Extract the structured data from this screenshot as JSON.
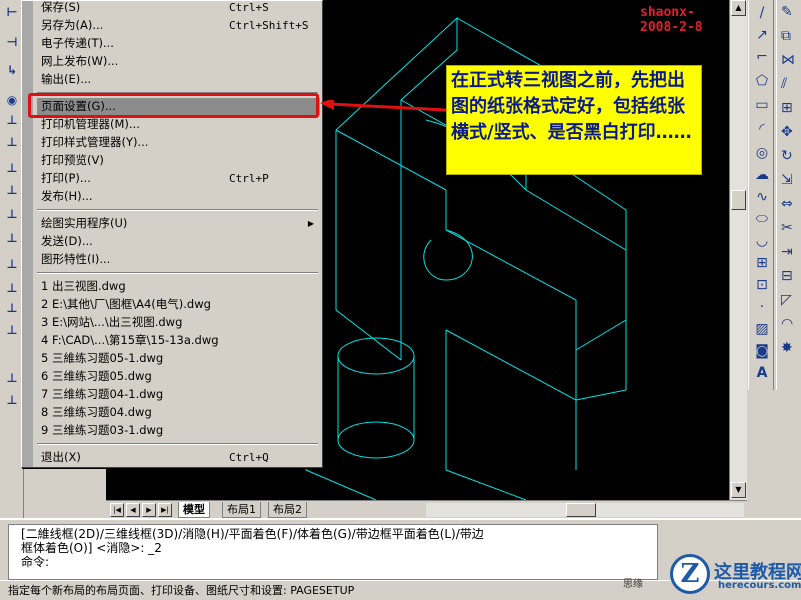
{
  "watermark_stamp": "shaonx-2008-2-8",
  "file_menu": {
    "items": [
      {
        "label": "保存(S)",
        "shortcut": "Ctrl+S"
      },
      {
        "label": "另存为(A)...",
        "shortcut": "Ctrl+Shift+S"
      },
      {
        "label": "电子传递(T)...",
        "shortcut": ""
      },
      {
        "label": "网上发布(W)...",
        "shortcut": ""
      },
      {
        "label": "输出(E)...",
        "shortcut": ""
      },
      {
        "label": "页面设置(G)...",
        "shortcut": ""
      },
      {
        "label": "打印机管理器(M)...",
        "shortcut": ""
      },
      {
        "label": "打印样式管理器(Y)...",
        "shortcut": ""
      },
      {
        "label": "打印预览(V)",
        "shortcut": ""
      },
      {
        "label": "打印(P)...",
        "shortcut": "Ctrl+P"
      },
      {
        "label": "发布(H)...",
        "shortcut": ""
      },
      {
        "label": "绘图实用程序(U)",
        "shortcut": ""
      },
      {
        "label": "发送(D)...",
        "shortcut": ""
      },
      {
        "label": "图形特性(I)...",
        "shortcut": ""
      },
      {
        "label": "1 出三视图.dwg",
        "shortcut": ""
      },
      {
        "label": "2 E:\\其他\\厂\\图框\\A4(电气).dwg",
        "shortcut": ""
      },
      {
        "label": "3 E:\\网站\\...\\出三视图.dwg",
        "shortcut": ""
      },
      {
        "label": "4 F:\\CAD\\...\\第15章\\15-13a.dwg",
        "shortcut": ""
      },
      {
        "label": "5 三維练习题05-1.dwg",
        "shortcut": ""
      },
      {
        "label": "6 三维练习题05.dwg",
        "shortcut": ""
      },
      {
        "label": "7 三维练习题04-1.dwg",
        "shortcut": ""
      },
      {
        "label": "8 三维练习题04.dwg",
        "shortcut": ""
      },
      {
        "label": "9 三维练习题03-1.dwg",
        "shortcut": ""
      },
      {
        "label": "退出(X)",
        "shortcut": "Ctrl+Q"
      }
    ]
  },
  "callout": {
    "text": "在正式转三视图之前，先把出图的纸张格式定好，包括纸张横式/竖式、是否黑白打印……"
  },
  "tabs": [
    {
      "label": "模型"
    },
    {
      "label": "布局1"
    },
    {
      "label": "布局2"
    }
  ],
  "command": {
    "line1": "[二維线框(2D)/三维线框(3D)/消隐(H)/平面着色(F)/体着色(G)/带边框平面着色(L)/带边",
    "line2": "框体着色(O)] <消隐>: _2",
    "line3": "命令:"
  },
  "status": {
    "text": "指定每个新布局的布局页面、打印设备、图纸尺寸和设置:  PAGESETUP",
    "side": "思缘"
  },
  "logo": {
    "letter": "Z",
    "title": "这里教程网",
    "url": "herecours.com"
  },
  "colors": {
    "highlight_border": "#e01010",
    "callout_bg": "#ffff00",
    "callout_text": "#0a1a8a",
    "wireframe": "#00e5e5"
  }
}
